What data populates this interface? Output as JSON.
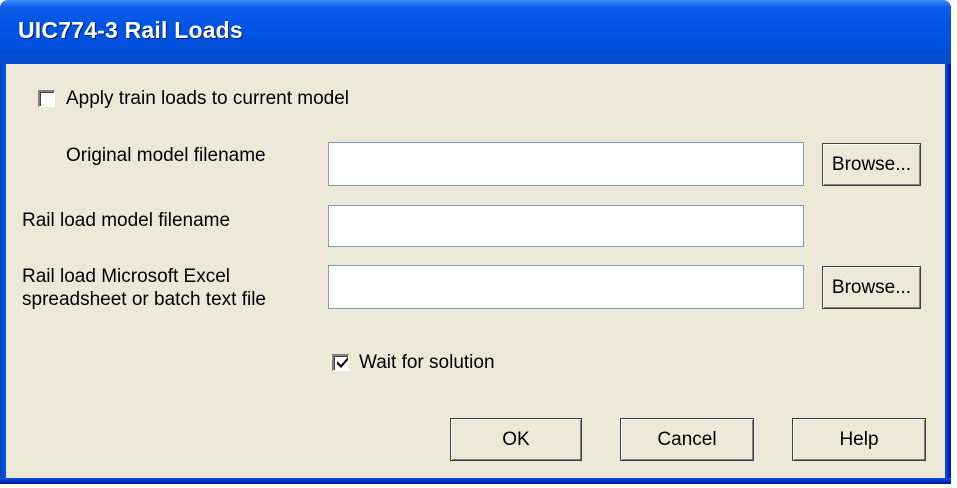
{
  "window": {
    "title": "UIC774-3 Rail Loads"
  },
  "form": {
    "apply_checkbox": {
      "label": "Apply train loads to current model",
      "checked": false
    },
    "original_model": {
      "label": "Original model filename",
      "value": "",
      "browse_label": "Browse..."
    },
    "rail_load_model": {
      "label": "Rail load model filename",
      "value": ""
    },
    "rail_load_excel": {
      "label_line1": "Rail load Microsoft Excel",
      "label_line2": "spreadsheet or batch text file",
      "value": "",
      "browse_label": "Browse..."
    },
    "wait_checkbox": {
      "label": "Wait for solution",
      "checked": true
    }
  },
  "buttons": {
    "ok_label": "OK",
    "cancel_label": "Cancel",
    "help_label": "Help"
  },
  "colors": {
    "titlebar": "#0054e3",
    "dialog_bg": "#ece9d8",
    "title_text": "#ffffff"
  }
}
